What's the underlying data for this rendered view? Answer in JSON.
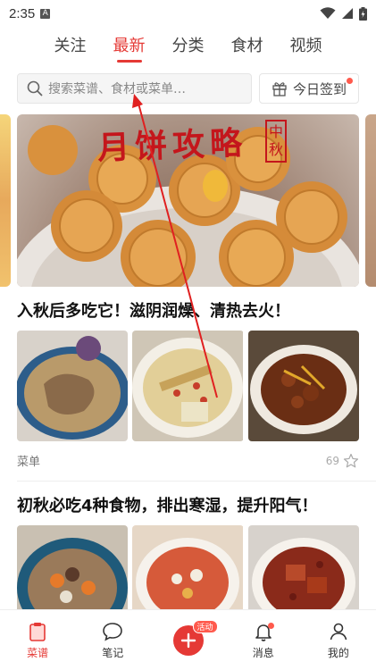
{
  "status_bar": {
    "time": "2:35",
    "a_label": "A"
  },
  "tabs": [
    {
      "label": "关注",
      "active": false
    },
    {
      "label": "最新",
      "active": true
    },
    {
      "label": "分类",
      "active": false
    },
    {
      "label": "食材",
      "active": false
    },
    {
      "label": "视频",
      "active": false
    }
  ],
  "search": {
    "placeholder": "搜索菜谱、食材或菜单…"
  },
  "checkin": {
    "label": "今日签到"
  },
  "banner": {
    "title": "月饼攻略",
    "seal_top": "中",
    "seal_bottom": "秋"
  },
  "posts": [
    {
      "title": "入秋后多吃它！滋阴润燥、清热去火！",
      "tag": "菜单",
      "likes": "69"
    },
    {
      "title": "初秋必吃4种食物，排出寒湿，提升阳气！"
    }
  ],
  "bottom_nav": {
    "items": [
      {
        "label": "菜谱",
        "active": true
      },
      {
        "label": "笔记",
        "active": false
      },
      {
        "label": "",
        "badge": "活动"
      },
      {
        "label": "消息",
        "active": false
      },
      {
        "label": "我的",
        "active": false
      }
    ]
  },
  "colors": {
    "accent": "#e53935",
    "badge": "#ff5a4d"
  }
}
